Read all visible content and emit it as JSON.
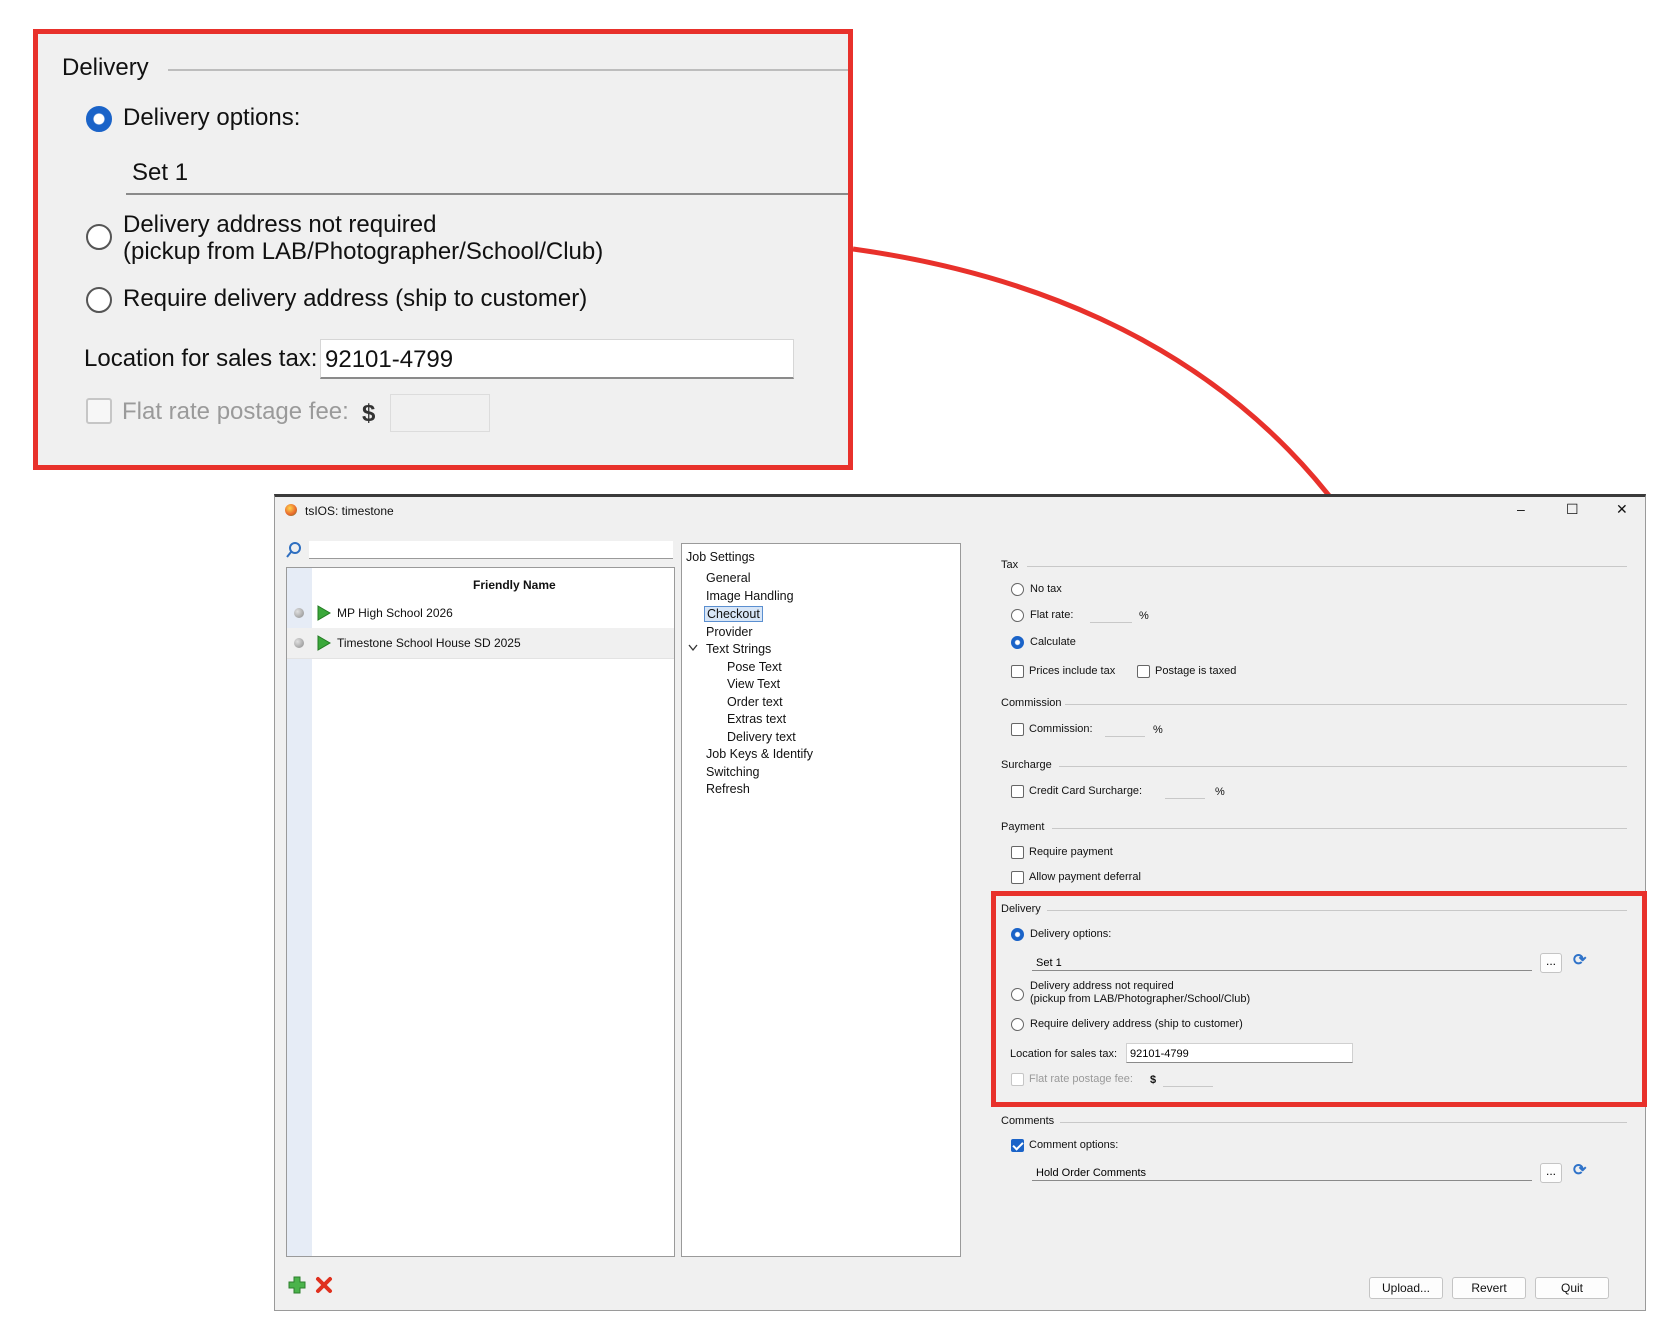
{
  "zoom": {
    "group_title": "Delivery",
    "delivery_options_label": "Delivery options:",
    "set_value": "Set 1",
    "not_required_line1": "Delivery address not required",
    "not_required_line2": "(pickup from LAB/Photographer/School/Club)",
    "require_address_label": "Require delivery address (ship to customer)",
    "sales_tax_label": "Location for sales tax:",
    "sales_tax_value": "92101-4799",
    "flat_rate_label": "Flat rate postage fee:",
    "currency": "$"
  },
  "window": {
    "title": "tsIOS: timestone",
    "controls": {
      "minimize": "–",
      "maximize": "☐",
      "close": "✕"
    }
  },
  "jobs": {
    "column_header": "Friendly Name",
    "rows": [
      {
        "name": "MP High School 2026"
      },
      {
        "name": "Timestone School House SD 2025"
      }
    ]
  },
  "tree": {
    "root": "Job Settings",
    "items": [
      "General",
      "Image Handling",
      "Checkout",
      "Provider",
      "Text Strings"
    ],
    "text_strings_children": [
      "Pose Text",
      "View Text",
      "Order text",
      "Extras text",
      "Delivery text"
    ],
    "items_after": [
      "Job Keys & Identify",
      "Switching",
      "Refresh"
    ],
    "selected": "Checkout"
  },
  "settings": {
    "tax": {
      "title": "Tax",
      "no_tax": "No tax",
      "flat_rate": "Flat rate:",
      "percent": "%",
      "calculate": "Calculate",
      "prices_include_tax": "Prices include tax",
      "postage_is_taxed": "Postage is taxed"
    },
    "commission": {
      "title": "Commission",
      "label": "Commission:",
      "percent": "%"
    },
    "surcharge": {
      "title": "Surcharge",
      "label": "Credit Card Surcharge:",
      "percent": "%"
    },
    "payment": {
      "title": "Payment",
      "require_payment": "Require payment",
      "allow_deferral": "Allow payment deferral"
    },
    "delivery": {
      "title": "Delivery",
      "delivery_options": "Delivery options:",
      "set_value": "Set 1",
      "not_required_line1": "Delivery address not required",
      "not_required_line2": "(pickup from LAB/Photographer/School/Club)",
      "require_address": "Require delivery address (ship to customer)",
      "sales_tax_label": "Location for sales tax:",
      "sales_tax_value": "92101-4799",
      "flat_rate_label": "Flat rate postage fee:",
      "currency": "$"
    },
    "comments": {
      "title": "Comments",
      "comment_options": "Comment options:",
      "value": "Hold Order Comments"
    },
    "ellipsis": "..."
  },
  "footer": {
    "upload": "Upload...",
    "revert": "Revert",
    "quit": "Quit"
  },
  "colors": {
    "highlight_border": "#e8312b",
    "accent": "#1a63c8",
    "play_green": "#3aa83a",
    "delete_red": "#e0301e"
  }
}
